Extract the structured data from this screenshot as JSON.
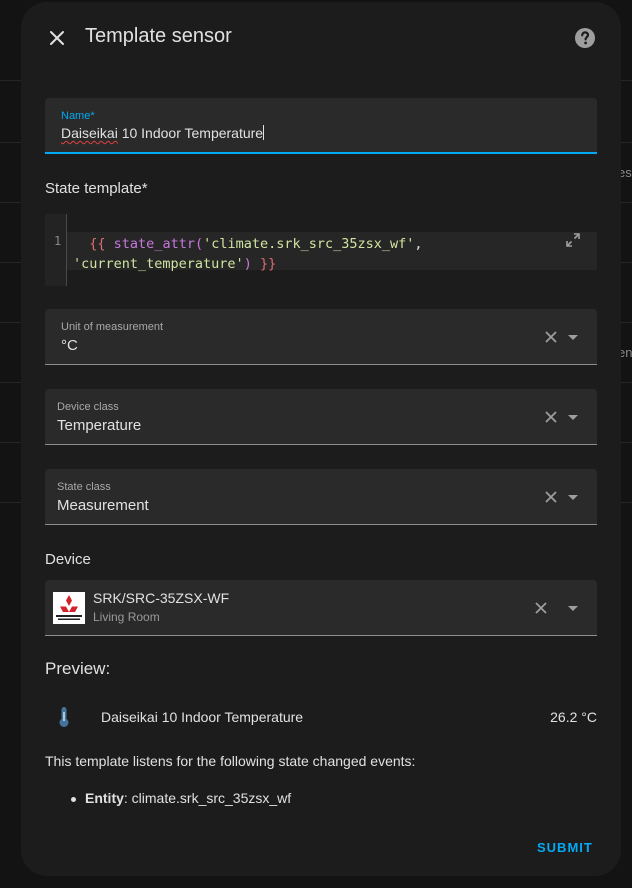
{
  "background": {
    "peek_1": "es",
    "peek_2": "en"
  },
  "dialog": {
    "title": "Template sensor"
  },
  "name_field": {
    "label": "Name*",
    "value_underlined": "Daiseikai",
    "value_rest": " 10 Indoor Temperature"
  },
  "state_template": {
    "label": "State template*",
    "line_number": "1",
    "code": {
      "open": "{{",
      "func": "state_attr",
      "paren_open": "(",
      "arg1": "'climate.srk_src_35zsx_wf'",
      "comma": ",",
      "arg2": "'current_temperature'",
      "paren_close": ")",
      "close": "}}"
    }
  },
  "unit_field": {
    "label": "Unit of measurement",
    "value": "°C"
  },
  "device_class_field": {
    "label": "Device class",
    "value": "Temperature"
  },
  "state_class_field": {
    "label": "State class",
    "value": "Measurement"
  },
  "device": {
    "label": "Device",
    "name": "SRK/SRC-35ZSX-WF",
    "area": "Living Room"
  },
  "preview": {
    "label": "Preview:",
    "entity_name": "Daiseikai 10 Indoor Temperature",
    "state": "26.2 °C",
    "icon": "thermometer-icon"
  },
  "listeners": {
    "text": "This template listens for the following state changed events:",
    "entity_label": "Entity",
    "entity_value": ": climate.srk_src_35zsx_wf"
  },
  "actions": {
    "submit_label": "SUBMIT"
  },
  "colors": {
    "accent": "#03a9f4",
    "dialog_bg": "#1c1c1c",
    "field_bg": "#2a2a2a"
  }
}
